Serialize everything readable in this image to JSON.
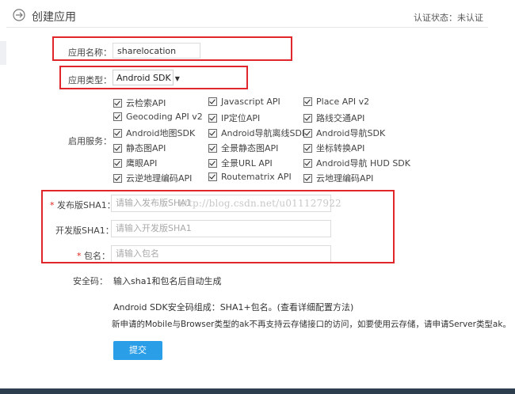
{
  "header": {
    "title": "创建应用",
    "status": "认证状态：未认证"
  },
  "form": {
    "app_name": {
      "label": "应用名称：",
      "value": "sharelocation"
    },
    "app_type": {
      "label": "应用类型：",
      "value": "Android SDK"
    },
    "services": {
      "label": "启用服务：",
      "items": [
        "云检索API",
        "Javascript API",
        "Place API v2",
        "Geocoding API v2",
        "IP定位API",
        "路线交通API",
        "Android地图SDK",
        "Android导航离线SDK",
        "Android导航SDK",
        "静态图API",
        "全景静态图API",
        "坐标转换API",
        "鹰眼API",
        "全景URL API",
        "Android导航 HUD SDK",
        "云逆地理编码API",
        "Routematrix API",
        "云地理编码API"
      ]
    },
    "release_sha1": {
      "label": "发布版SHA1：",
      "required_mark": "*",
      "placeholder": "请输入发布版SHA1"
    },
    "debug_sha1": {
      "label": "开发版SHA1：",
      "placeholder": "请输入开发版SHA1"
    },
    "package_name": {
      "label": "包名：",
      "required_mark": "*",
      "placeholder": "请输入包名"
    },
    "security_code": {
      "label": "安全码：",
      "value": "输入sha1和包名后自动生成"
    },
    "note1": "Android SDK安全码组成：SHA1+包名。(查看详细配置方法)",
    "note2": "新申请的Mobile与Browser类型的ak不再支持云存储接口的访问，如要使用云存储，请申请Server类型ak。",
    "submit_label": "提交"
  },
  "watermark": "http://blog.csdn.net/u011127922",
  "colors": {
    "accent": "#2b9ee8",
    "highlight": "#e0262b",
    "footer": "#2d3e4f"
  }
}
